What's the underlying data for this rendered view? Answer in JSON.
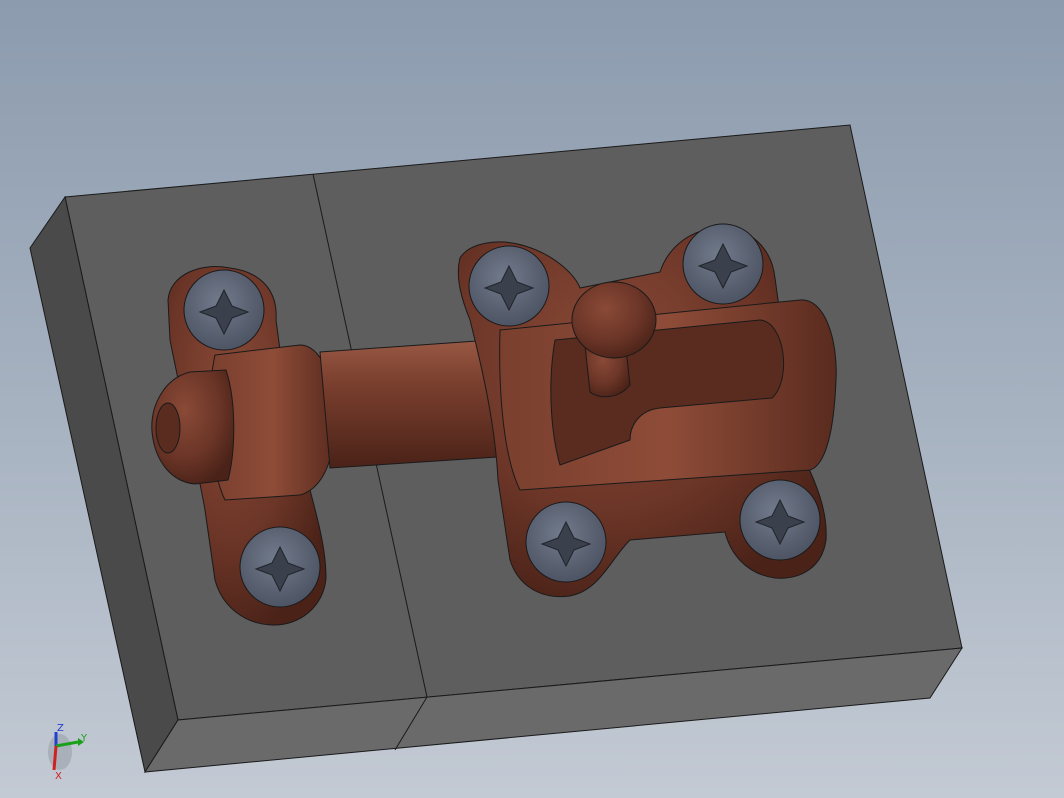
{
  "viewport": {
    "background_top": "#8c9bae",
    "background_bottom": "#c3cad4"
  },
  "model": {
    "base_color": "#5e5e5e",
    "latch_color": "#6b3527",
    "screw_color": "#5a6273"
  },
  "triad": {
    "z_label": "Z",
    "y_label": "Y",
    "x_label": "X",
    "x_color": "#d02020",
    "y_color": "#1aa01a",
    "z_color": "#2040d0"
  }
}
